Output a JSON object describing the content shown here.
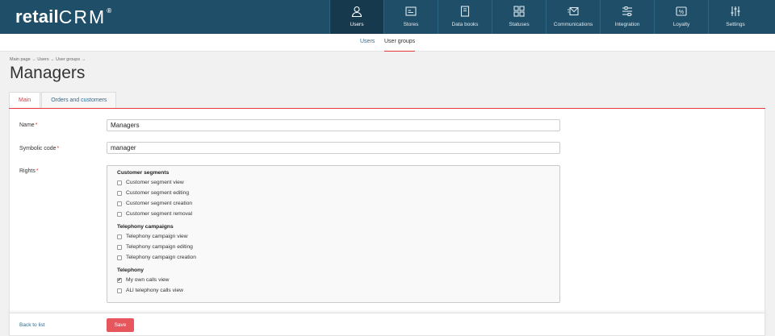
{
  "app": {
    "logo_text": "retail",
    "logo_crm": "CRM",
    "logo_reg": "®"
  },
  "nav": [
    {
      "label": "Users",
      "icon": "user-icon",
      "active": true
    },
    {
      "label": "Stores",
      "icon": "store-icon",
      "active": false
    },
    {
      "label": "Data books",
      "icon": "book-icon",
      "active": false
    },
    {
      "label": "Statuses",
      "icon": "statuses-grid-icon",
      "active": false
    },
    {
      "label": "Communications",
      "icon": "mail-icon",
      "active": false
    },
    {
      "label": "Integration",
      "icon": "integration-icon",
      "active": false
    },
    {
      "label": "Loyalty",
      "icon": "percent-icon",
      "active": false
    },
    {
      "label": "Settings",
      "icon": "sliders-icon",
      "active": false
    }
  ],
  "subnav": {
    "users": "Users",
    "user_groups": "User groups"
  },
  "breadcrumb": "Main page → Users → User groups →",
  "page_title": "Managers",
  "tabs": {
    "main": "Main",
    "orders": "Orders and customers"
  },
  "form": {
    "name_label": "Name",
    "name_value": "Managers",
    "code_label": "Symbolic code",
    "code_value": "manager",
    "rights_label": "Rights",
    "required_mark": "*"
  },
  "rights": {
    "segments_title": "Customer segments",
    "segments": [
      {
        "label": "Customer segment view",
        "checked": false
      },
      {
        "label": "Customer segment editing",
        "checked": false
      },
      {
        "label": "Customer segment creation",
        "checked": false
      },
      {
        "label": "Customer segment removal",
        "checked": false
      }
    ],
    "campaigns_title": "Telephony campaigns",
    "campaigns": [
      {
        "label": "Telephony campaign view",
        "checked": false
      },
      {
        "label": "Telephony campaign editing",
        "checked": false
      },
      {
        "label": "Telephony campaign creation",
        "checked": false
      }
    ],
    "telephony_title": "Telephony",
    "telephony": [
      {
        "label": "My own calls view",
        "checked": true
      },
      {
        "label": "ALl telephony calls view",
        "checked": false
      }
    ],
    "check_glyph": "✔"
  },
  "footer": {
    "back_label": "Back to list",
    "save_label": "Save"
  },
  "colors": {
    "topbar": "#1f4e68",
    "accent": "#e4393c",
    "link": "#2b6c95"
  }
}
